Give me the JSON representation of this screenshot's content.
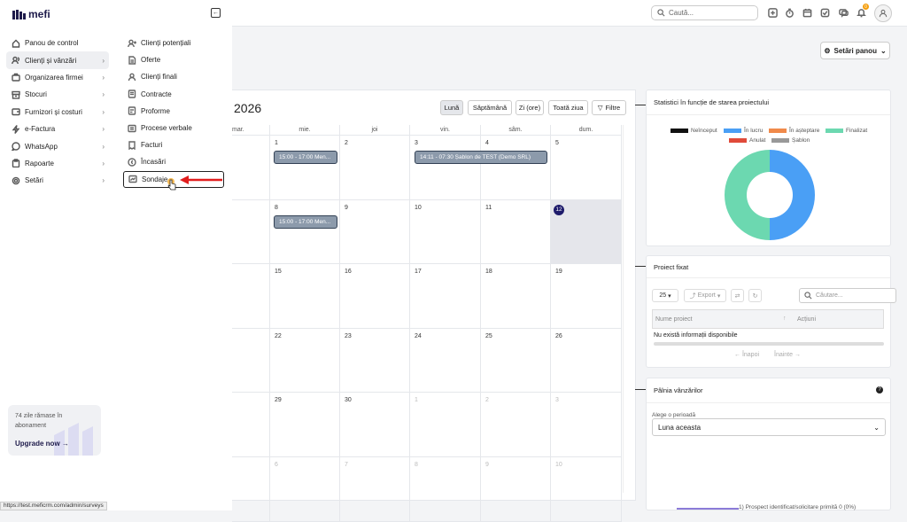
{
  "app": {
    "logo_text": "mefi",
    "brand_color": "#1e1b4b"
  },
  "topbar": {
    "search_placeholder": "Caută...",
    "notification_count": "0"
  },
  "settings_button": "Setări panou",
  "sidebar": {
    "items": [
      {
        "label": "Panou de control",
        "icon": "home-icon",
        "chevron": false
      },
      {
        "label": "Clienți și vânzări",
        "icon": "users-icon",
        "chevron": true,
        "active": true
      },
      {
        "label": "Organizarea firmei",
        "icon": "briefcase-icon",
        "chevron": true
      },
      {
        "label": "Stocuri",
        "icon": "box-icon",
        "chevron": true
      },
      {
        "label": "Furnizori și costuri",
        "icon": "wallet-icon",
        "chevron": true
      },
      {
        "label": "e-Factura",
        "icon": "lightning-icon",
        "chevron": true
      },
      {
        "label": "WhatsApp",
        "icon": "chat-icon",
        "chevron": true
      },
      {
        "label": "Rapoarte",
        "icon": "clipboard-icon",
        "chevron": true
      },
      {
        "label": "Setări",
        "icon": "gear-icon",
        "chevron": true
      }
    ]
  },
  "submenu": {
    "items": [
      {
        "label": "Clienți potențiali",
        "icon": "user-plus-icon"
      },
      {
        "label": "Oferte",
        "icon": "document-icon"
      },
      {
        "label": "Clienți finali",
        "icon": "user-icon"
      },
      {
        "label": "Contracte",
        "icon": "contract-icon"
      },
      {
        "label": "Proforme",
        "icon": "proforma-icon"
      },
      {
        "label": "Procese verbale",
        "icon": "report-icon"
      },
      {
        "label": "Facturi",
        "icon": "invoice-icon"
      },
      {
        "label": "Încasări",
        "icon": "coin-icon"
      },
      {
        "label": "Sondaje",
        "icon": "survey-icon",
        "highlighted": true
      }
    ]
  },
  "trial": {
    "text": "74 zile rămase în abonament",
    "upgrade": "Upgrade now"
  },
  "status_url": "https://test.meficrm.com/admin/surveys",
  "calendar": {
    "title": "2026",
    "view_buttons": [
      "Lună",
      "Săptămână",
      "Zi (ore)",
      "Toată ziua",
      "Filtre"
    ],
    "active_view": "Lună",
    "day_headers": [
      "mar.",
      "mie.",
      "joi",
      "vin.",
      "sâm.",
      "dum."
    ],
    "weeks": [
      [
        "",
        "1",
        "2",
        "3",
        "4",
        "5"
      ],
      [
        "",
        "8",
        "9",
        "10",
        "11",
        "12"
      ],
      [
        "",
        "15",
        "16",
        "17",
        "18",
        "19"
      ],
      [
        "",
        "22",
        "23",
        "24",
        "25",
        "26"
      ],
      [
        "",
        "29",
        "30",
        "1",
        "2",
        "3"
      ],
      [
        "",
        "6",
        "7",
        "8",
        "9",
        "10"
      ]
    ],
    "today": "12",
    "events": [
      {
        "text": "15:00 - 17:00 Men..."
      },
      {
        "text": "14:11 - 07:30 Șablon de TEST (Demo SRL)"
      },
      {
        "text": "15:00 - 17:00 Men..."
      }
    ]
  },
  "stats_panel": {
    "title": "Statistici în funcție de starea proiectului",
    "legend": [
      {
        "label": "Neînceput",
        "color": "#111111"
      },
      {
        "label": "În lucru",
        "color": "#4a9ff5"
      },
      {
        "label": "În așteptare",
        "color": "#f08a4b"
      },
      {
        "label": "Finalizat",
        "color": "#6cd8b0"
      },
      {
        "label": "Anulat",
        "color": "#e04a3a"
      },
      {
        "label": "Șablon",
        "color": "#999999"
      }
    ]
  },
  "chart_data": {
    "type": "pie",
    "categories": [
      "Neînceput",
      "În lucru",
      "În așteptare",
      "Finalizat",
      "Anulat",
      "Șablon"
    ],
    "values": [
      0,
      50,
      0,
      50,
      0,
      0
    ]
  },
  "fixed_panel": {
    "title": "Proiect fixat",
    "page_size": "25",
    "export": "Export",
    "search_placeholder": "Căutare...",
    "columns": [
      "Nume proiect",
      "Acțiuni"
    ],
    "empty": "Nu există informații disponibile",
    "prev": "← Înapoi",
    "next": "Înainte →"
  },
  "sales_panel": {
    "title": "Pâlnia vânzărilor",
    "period_label": "Alege o perioadă",
    "period_value": "Luna aceasta",
    "funnel_label": "1) Prospect identificat/solicitare primită 0 (0%)"
  }
}
